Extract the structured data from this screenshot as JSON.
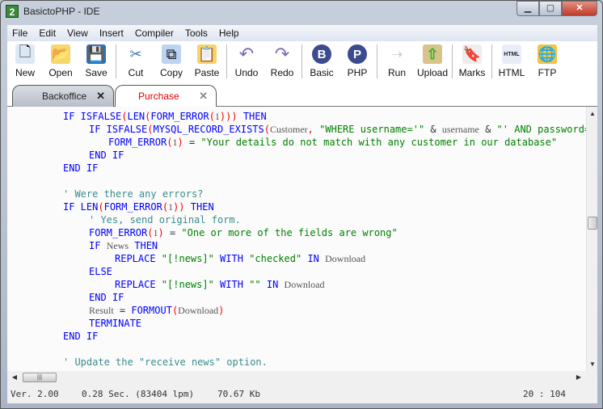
{
  "window": {
    "title": "BasictoPHP - IDE",
    "app_icon": "2",
    "controls": {
      "minimize": "▁",
      "maximize": "▢",
      "close": "✕"
    }
  },
  "menu": [
    "File",
    "Edit",
    "View",
    "Insert",
    "Compiler",
    "Tools",
    "Help"
  ],
  "toolbar": [
    {
      "label": "New",
      "icon": "new-file-icon",
      "glyph": "🗋",
      "color": "#dde8f5"
    },
    {
      "label": "Open",
      "icon": "open-folder-icon",
      "glyph": "📂",
      "color": "#f5d76e"
    },
    {
      "label": "Save",
      "icon": "save-icon",
      "glyph": "💾",
      "color": "#2f6fc4"
    },
    {
      "sep": true
    },
    {
      "label": "Cut",
      "icon": "scissors-icon",
      "glyph": "✂",
      "color": "#fff"
    },
    {
      "label": "Copy",
      "icon": "copy-icon",
      "glyph": "⧉",
      "color": "#bcd4f2"
    },
    {
      "label": "Paste",
      "icon": "paste-icon",
      "glyph": "📋",
      "color": "#f7d36b"
    },
    {
      "sep": true
    },
    {
      "label": "Undo",
      "icon": "undo-icon",
      "glyph": "↶",
      "color": "#fff"
    },
    {
      "label": "Redo",
      "icon": "redo-icon",
      "glyph": "↷",
      "color": "#fff"
    },
    {
      "sep": true
    },
    {
      "label": "Basic",
      "icon": "basic-icon",
      "glyph": "B",
      "color": "#3b4b8e"
    },
    {
      "label": "PHP",
      "icon": "php-icon",
      "glyph": "P",
      "color": "#3b4b8e"
    },
    {
      "sep": true
    },
    {
      "label": "Run",
      "icon": "run-icon",
      "glyph": "➝",
      "color": "#fff"
    },
    {
      "label": "Upload",
      "icon": "upload-icon",
      "glyph": "⇧",
      "color": "#d8c48a"
    },
    {
      "sep": true
    },
    {
      "label": "Marks",
      "icon": "bookmark-icon",
      "glyph": "🔖",
      "color": "#eee"
    },
    {
      "sep": true
    },
    {
      "label": "HTML",
      "icon": "html-icon",
      "glyph": "HTML",
      "color": "#e8eef8"
    },
    {
      "label": "FTP",
      "icon": "ftp-icon",
      "glyph": "🌐",
      "color": "#f5c242"
    }
  ],
  "tabs": [
    {
      "label": "Backoffice",
      "active": false
    },
    {
      "label": "Purchase",
      "active": true
    }
  ],
  "code": [
    {
      "indent": 0,
      "tokens": [
        [
          "k",
          "IF ISFALSE"
        ],
        [
          "p",
          "("
        ],
        [
          "k",
          "LEN"
        ],
        [
          "p",
          "("
        ],
        [
          "k",
          "FORM_ERROR"
        ],
        [
          "p",
          "("
        ],
        [
          "i",
          "1"
        ],
        [
          "p",
          ")))"
        ],
        [
          "o",
          " "
        ],
        [
          "k",
          "THEN"
        ]
      ]
    },
    {
      "indent": 4,
      "tokens": [
        [
          "k",
          "IF ISFALSE"
        ],
        [
          "p",
          "("
        ],
        [
          "k",
          "MYSQL_RECORD_EXISTS"
        ],
        [
          "p",
          "("
        ],
        [
          "i",
          "Customer"
        ],
        [
          "p",
          ","
        ],
        [
          "o",
          " "
        ],
        [
          "s",
          "\"WHERE username='\""
        ],
        [
          "o",
          " & "
        ],
        [
          "i",
          "username"
        ],
        [
          "o",
          " & "
        ],
        [
          "s",
          "\"' AND password='\""
        ]
      ]
    },
    {
      "indent": 7,
      "tokens": [
        [
          "k",
          "FORM_ERROR"
        ],
        [
          "p",
          "("
        ],
        [
          "i",
          "1"
        ],
        [
          "p",
          ")"
        ],
        [
          "o",
          " = "
        ],
        [
          "s",
          "\"Your details do not match with any customer in our database\""
        ]
      ]
    },
    {
      "indent": 4,
      "tokens": [
        [
          "k",
          "END IF"
        ]
      ]
    },
    {
      "indent": 0,
      "tokens": [
        [
          "k",
          "END IF"
        ]
      ]
    },
    {
      "indent": 0,
      "tokens": []
    },
    {
      "indent": 0,
      "tokens": [
        [
          "c",
          "' Were there any errors?"
        ]
      ]
    },
    {
      "indent": 0,
      "tokens": [
        [
          "k",
          "IF LEN"
        ],
        [
          "p",
          "("
        ],
        [
          "k",
          "FORM_ERROR"
        ],
        [
          "p",
          "("
        ],
        [
          "i",
          "1"
        ],
        [
          "p",
          "))"
        ],
        [
          "o",
          " "
        ],
        [
          "k",
          "THEN"
        ]
      ]
    },
    {
      "indent": 4,
      "tokens": [
        [
          "c",
          "' Yes, send original form."
        ]
      ]
    },
    {
      "indent": 4,
      "tokens": [
        [
          "k",
          "FORM_ERROR"
        ],
        [
          "p",
          "("
        ],
        [
          "i",
          "1"
        ],
        [
          "p",
          ")"
        ],
        [
          "o",
          " = "
        ],
        [
          "s",
          "\"One or more of the fields are wrong\""
        ]
      ]
    },
    {
      "indent": 4,
      "tokens": [
        [
          "k",
          "IF "
        ],
        [
          "i",
          "News"
        ],
        [
          "k",
          " THEN"
        ]
      ]
    },
    {
      "indent": 8,
      "tokens": [
        [
          "k",
          "REPLACE "
        ],
        [
          "s",
          "\"[!news]\""
        ],
        [
          "k",
          " WITH "
        ],
        [
          "s",
          "\"checked\""
        ],
        [
          "k",
          " IN "
        ],
        [
          "i",
          "Download"
        ]
      ]
    },
    {
      "indent": 4,
      "tokens": [
        [
          "k",
          "ELSE"
        ]
      ]
    },
    {
      "indent": 8,
      "tokens": [
        [
          "k",
          "REPLACE "
        ],
        [
          "s",
          "\"[!news]\""
        ],
        [
          "k",
          " WITH "
        ],
        [
          "s",
          "\"\""
        ],
        [
          "k",
          " IN "
        ],
        [
          "i",
          "Download"
        ]
      ]
    },
    {
      "indent": 4,
      "tokens": [
        [
          "k",
          "END IF"
        ]
      ]
    },
    {
      "indent": 4,
      "tokens": [
        [
          "i",
          "Result"
        ],
        [
          "o",
          " = "
        ],
        [
          "k",
          "FORMOUT"
        ],
        [
          "p",
          "("
        ],
        [
          "i",
          "Download"
        ],
        [
          "p",
          ")"
        ]
      ]
    },
    {
      "indent": 4,
      "tokens": [
        [
          "k",
          "TERMINATE"
        ]
      ]
    },
    {
      "indent": 0,
      "tokens": [
        [
          "k",
          "END IF"
        ]
      ]
    },
    {
      "indent": 0,
      "tokens": []
    },
    {
      "indent": 0,
      "tokens": [
        [
          "c",
          "' Update the \"receive news\" option."
        ]
      ]
    }
  ],
  "scroll": {
    "vertical_position": 0.45,
    "horizontal_position": 0.0
  },
  "status": {
    "version": "Ver. 2.00",
    "timing": "0.28 Sec. (83404 lpm)",
    "size": "70.67 Kb",
    "cursor": "20 : 104"
  }
}
